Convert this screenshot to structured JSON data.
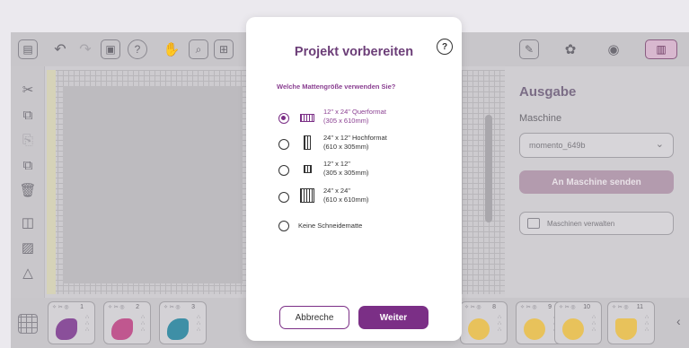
{
  "modal": {
    "title": "Projekt vorbereiten",
    "help_symbol": "?",
    "question": "Welche Mattengröße verwenden Sie?",
    "options": [
      {
        "line1": "12\" x 24\" Querformat",
        "line2": "(305 x 610mm)",
        "selected": true,
        "icon": "landscape-mat-icon"
      },
      {
        "line1": "24\" x 12\" Hochformat",
        "line2": "(610 x 305mm)",
        "selected": false,
        "icon": "portrait-mat-icon"
      },
      {
        "line1": "12\" x 12\"",
        "line2": "(305 x 305mm)",
        "selected": false,
        "icon": "square-small-mat-icon"
      },
      {
        "line1": "24\" x 24\"",
        "line2": "(610 x 610mm)",
        "selected": false,
        "icon": "square-large-mat-icon"
      },
      {
        "line1": "Keine Schneidematte",
        "line2": "",
        "selected": false,
        "icon": ""
      }
    ],
    "cancel_label": "Abbreche",
    "next_label": "Weiter"
  },
  "right_panel": {
    "title": "Ausgabe",
    "machine_label": "Maschine",
    "machine_value": "momento_649b",
    "send_label": "An Maschine senden",
    "manage_label": "Maschinen verwalten"
  },
  "layers": [
    {
      "number": "1",
      "color": "#8a4f9a",
      "shape": "blob"
    },
    {
      "number": "2",
      "color": "#c0578f",
      "shape": "blob"
    },
    {
      "number": "3",
      "color": "#3e8fa6",
      "shape": "blob"
    },
    {
      "number": "8",
      "color": "#e8c25b",
      "shape": "circle"
    },
    {
      "number": "9",
      "color": "#e8c25b",
      "shape": "circle"
    },
    {
      "number": "10",
      "color": "#e8c25b",
      "shape": "circle"
    },
    {
      "number": "11",
      "color": "#e8c25b",
      "shape": "mask"
    }
  ],
  "colors": {
    "accent": "#7b2f86",
    "title": "#6c3e78",
    "overlay_bg": "#cfcdd1"
  }
}
